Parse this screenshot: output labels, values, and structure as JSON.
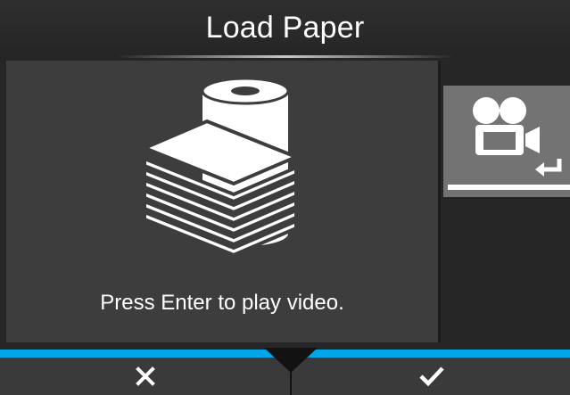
{
  "header": {
    "title": "Load Paper"
  },
  "main": {
    "prompt": "Press Enter to play video."
  },
  "side_button": {
    "icon": "video-camera-icon",
    "secondary_icon": "enter-key-icon"
  },
  "footer": {
    "cancel_icon": "close-icon",
    "confirm_icon": "checkmark-icon"
  },
  "colors": {
    "accent_bar": "#00a6e8",
    "panel": "#3d3d3d",
    "selected_button": "#737373",
    "background": "#262626"
  }
}
